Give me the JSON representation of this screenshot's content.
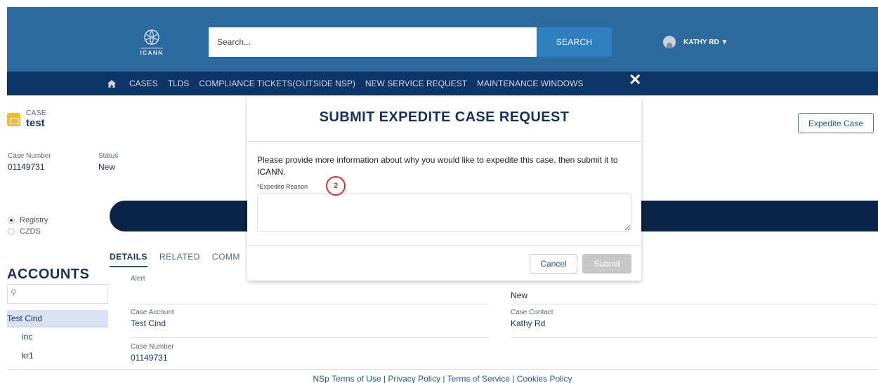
{
  "header": {
    "logo_text": "ICANN",
    "search_placeholder": "Search...",
    "search_button": "SEARCH",
    "user_name": "KATHY RD ▼"
  },
  "nav": {
    "items": [
      "CASES",
      "TLDS",
      "COMPLIANCE TICKETS(OUTSIDE NSP)",
      "NEW SERVICE REQUEST",
      "MAINTENANCE WINDOWS"
    ],
    "close_glyph": "✕"
  },
  "case": {
    "object_label": "CASE",
    "name": "test",
    "expedite_button": "Expedite Case",
    "case_number_label": "Case Number",
    "case_number": "01149731",
    "status_label": "Status",
    "status": "New"
  },
  "radios": [
    {
      "label": "Registry",
      "selected": true
    },
    {
      "label": "CZDS",
      "selected": false
    }
  ],
  "tabs": [
    "DETAILS",
    "RELATED",
    "COMM"
  ],
  "accounts": {
    "title": "ACCOUNTS",
    "items": [
      "Test Cind",
      "inc",
      "kr1"
    ]
  },
  "details": {
    "alert_label": "Alert",
    "status_value": "New",
    "case_account_label": "Case Account",
    "case_account": "Test Cind",
    "case_contact_label": "Case Contact",
    "case_contact": "Kathy Rd",
    "case_number_label": "Case Number",
    "case_number": "01149731"
  },
  "footer": {
    "text": "NSp Terms of Use | Privacy Policy | Terms of Service | Cookies Policy"
  },
  "modal": {
    "title": "SUBMIT EXPEDITE CASE REQUEST",
    "body": "Please provide more information about why you would like to expedite this case, then submit it to ICANN.",
    "required_star": "*",
    "field_label": "Expedite Reason",
    "callout_number": "2",
    "cancel": "Cancel",
    "submit": "Submit"
  }
}
